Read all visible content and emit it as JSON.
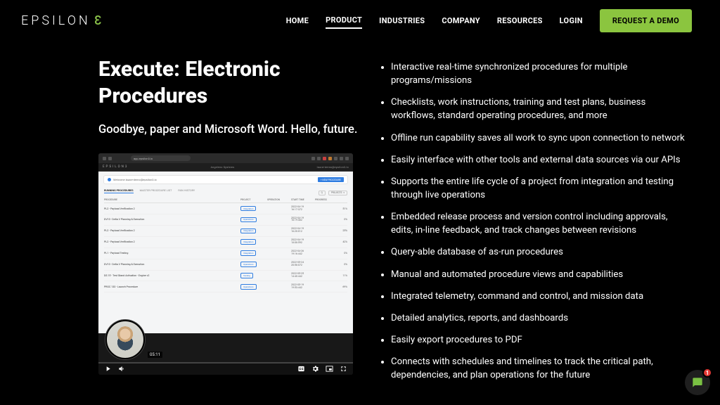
{
  "brand": {
    "name_prefix": "EPSILON",
    "name_suffix": "3"
  },
  "nav": {
    "items": [
      "HOME",
      "PRODUCT",
      "INDUSTRIES",
      "COMPANY",
      "RESOURCES",
      "LOGIN"
    ],
    "active_index": 1,
    "cta": "REQUEST A DEMO"
  },
  "hero": {
    "title": "Execute: Electronic Procedures",
    "subtitle": "Goodbye, paper and Microsoft Word. Hello, future."
  },
  "video": {
    "url": "app.epsilon3.io",
    "app_brand": "EPSILON3",
    "org": "Angeleno Systems",
    "user": "laura+demo@epsilon3.io",
    "welcome": "Welcome laura+demo@epsilon3.io",
    "new_btn": "+ NEW PROCEDURE",
    "projects_btn": "PROJECTS",
    "tabs": [
      "RUNNING PROCEDURES",
      "MASTER PROCEDURE LIST",
      "RUN HISTORY"
    ],
    "columns": [
      "PROCEDURE",
      "PROJECT",
      "OPERATION",
      "START TIME",
      "PROGRESS",
      ""
    ],
    "rows": [
      {
        "name": "PL2 - Payload Verification 2",
        "project": "Integration",
        "start": "2022-04-19\n16:17:372",
        "pct": "51%",
        "bar": 51,
        "red": false
      },
      {
        "name": "DV10 - Delta V Planning & Execution",
        "project": "Operations",
        "start": "2022-04-19\n16:19:302",
        "pct": "0%",
        "bar": 0,
        "red": false
      },
      {
        "name": "PL2 - Payload Verification 2",
        "project": "Integration",
        "start": "2022-04-19\n16:20:012",
        "pct": "25%",
        "bar": 25,
        "red": false
      },
      {
        "name": "PL2 - Payload Verification 2",
        "project": "Integration",
        "start": "2022-04-19\n18:08:592",
        "pct": "42%",
        "bar": 42,
        "red": true
      },
      {
        "name": "PL1 - Payload Testing",
        "project": "Integration",
        "start": "2022-04-26\n19:16:442",
        "pct": "0%",
        "bar": 0,
        "red": false
      },
      {
        "name": "DV10 - Delta V Planning & Execution",
        "project": "Operations",
        "start": "2022-05-24\n20:58:072",
        "pct": "0%",
        "bar": 0,
        "red": false
      },
      {
        "name": "DS 15 - Test Stand Activation - Engine v2",
        "project": "Testing",
        "start": "2022-05-25\n14:40:442",
        "pct": "11%",
        "bar": 11,
        "red": true
      },
      {
        "name": "PROC 133 - Launch Procedure",
        "project": "Operations",
        "start": "2022-05-19\n19:53:442",
        "pct": "69%",
        "bar": 69,
        "red": false
      }
    ],
    "timestamp": "05:11"
  },
  "bullets": [
    "Interactive real-time synchronized procedures for multiple programs/missions",
    "Checklists, work instructions, training and test plans, business workflows, standard operating procedures, and more",
    "Offline run capability saves all work to sync upon connection to network",
    "Easily interface with other tools and external data sources via our APIs",
    "Supports the entire life cycle of a project from integration and testing through live operations",
    "Embedded release process and version control including approvals, edits, in-line feedback, and track changes between revisions",
    "Query-able database of as-run procedures",
    "Manual and automated procedure views and capabilities",
    "Integrated telemetry, command and control, and mission data",
    "Detailed analytics, reports, and dashboards",
    "Easily export procedures to PDF",
    "Connects with schedules and timelines to track the critical path, dependencies, and plan operations for the future"
  ],
  "chat": {
    "unread": "1"
  }
}
